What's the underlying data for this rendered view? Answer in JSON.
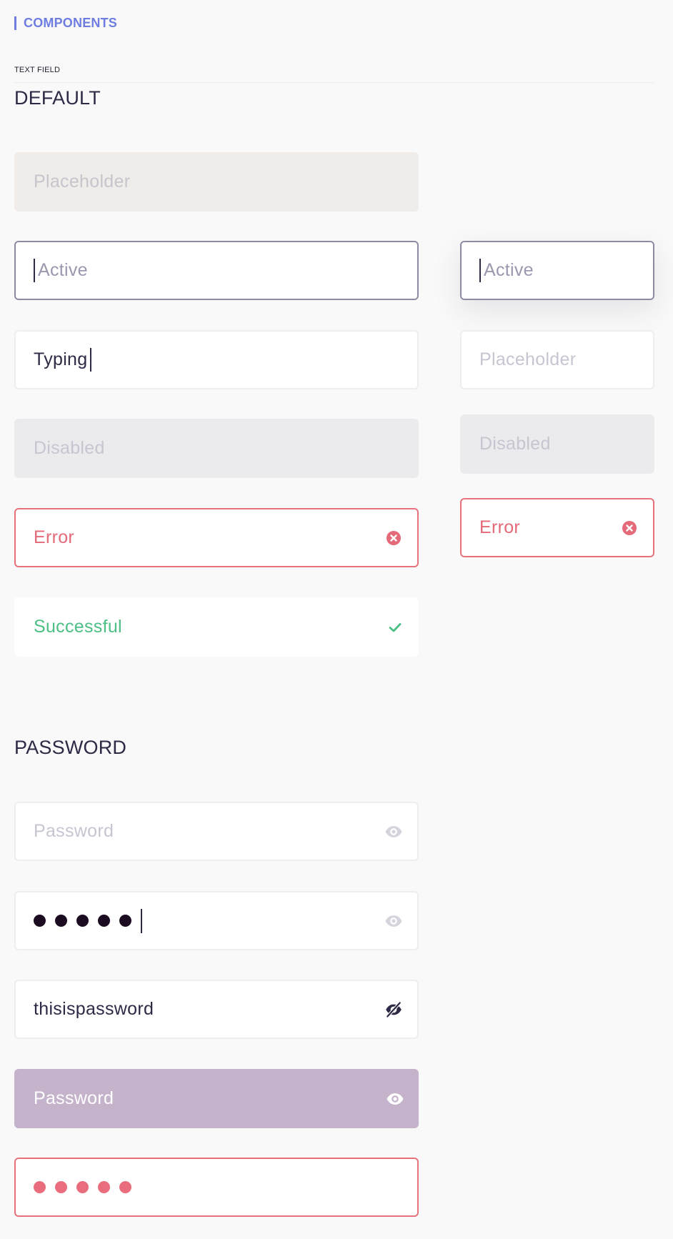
{
  "breadcrumb": {
    "label": "COMPONENTS"
  },
  "section_tag": "TEXT FIELD",
  "sections": {
    "default_title": "DEFAULT",
    "password_title": "PASSWORD"
  },
  "default_fields": {
    "filled_placeholder": "Placeholder",
    "active_large": "Active",
    "active_small": "Active",
    "typing_value": "Typing",
    "placeholder_small": "Placeholder",
    "disabled_large": "Disabled",
    "disabled_small": "Disabled",
    "error_large": "Error",
    "error_small": "Error",
    "success": "Successful"
  },
  "password_fields": {
    "empty_placeholder": "Password",
    "masked_dot_count": 5,
    "revealed_value": "thisispassword",
    "filled_placeholder": "Password",
    "error_dot_count": 5
  },
  "icons": {
    "error": "close-circle-icon",
    "success": "check-icon",
    "show_password": "eye-icon",
    "hide_password": "eye-off-icon"
  },
  "colors": {
    "accent": "#6e7de0",
    "error": "#e8717e",
    "success": "#4cbf85",
    "active_border": "#8d8ba3",
    "filled_purple": "#c4b3cb"
  }
}
